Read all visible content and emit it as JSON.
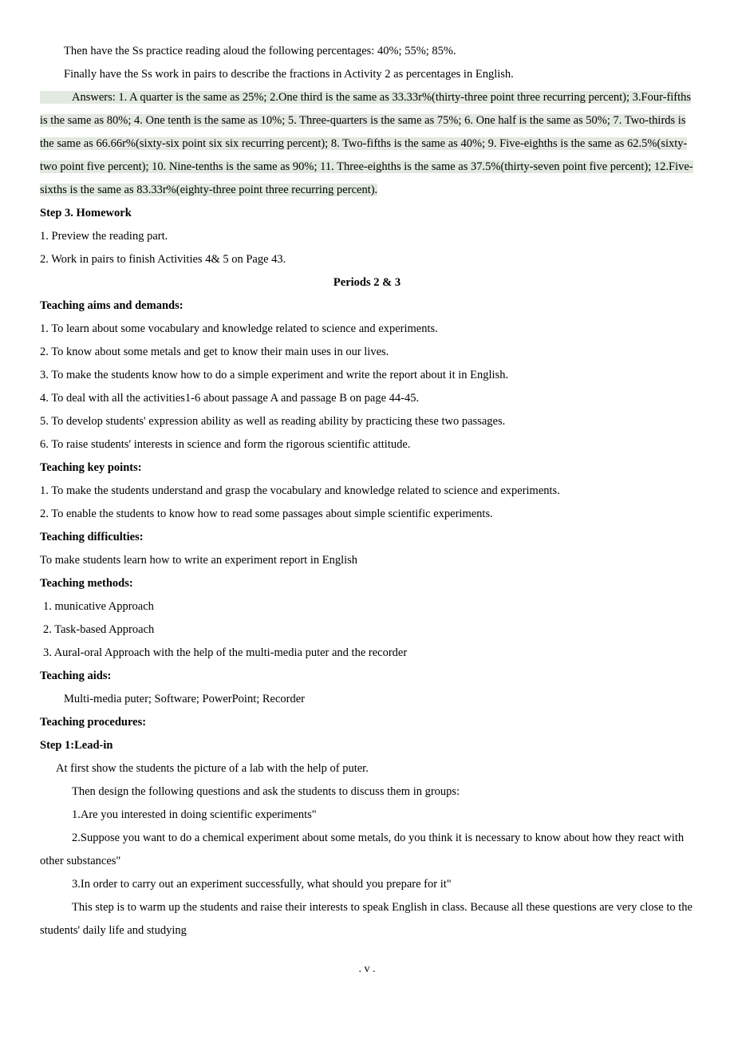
{
  "top": {
    "line1": "Then have the Ss practice reading aloud the following percentages: 40%; 55%; 85%.",
    "line2": "Finally have the Ss work in pairs to describe the fractions in Activity 2 as percentages in English.",
    "answers": "Answers: 1. A quarter is the same as 25%; 2.One third is the same as 33.33r%(thirty-three point three recurring percent); 3.Four-fifths is the same as 80%; 4. One tenth is the same as 10%; 5. Three-quarters is the same as 75%; 6. One half is the same as 50%; 7. Two-thirds is the same as 66.66r%(sixty-six point six six recurring percent); 8. Two-fifths is the same as 40%; 9. Five-eighths is the same as 62.5%(sixty-two point five percent); 10. Nine-tenths is the same as 90%; 11. Three-eighths is the same as 37.5%(thirty-seven point five percent); 12.Five-sixths is the same as 83.33r%(eighty-three point three recurring percent)."
  },
  "step3": {
    "heading": "Step 3. Homework",
    "item1": "1.    Preview the reading part.",
    "item2": "2.    Work in pairs to finish Activities 4& 5 on Page 43."
  },
  "periods": "Periods 2 & 3",
  "aims": {
    "heading": "Teaching aims and demands:",
    "i1": "1. To learn about some vocabulary and knowledge related to science and experiments.",
    "i2": "2. To know about some metals and get to know their main uses in our lives.",
    "i3": "3. To make the students know how to do a simple experiment and write the report about it in English.",
    "i4": "4. To deal with all the activities1-6 about passage A and passage B on page 44-45.",
    "i5": "5. To develop students'  expression ability as well as reading ability by practicing these two passages.",
    "i6": "6. To raise students'  interests in science and form the rigorous scientific attitude."
  },
  "keypoints": {
    "heading": "Teaching key points:",
    "i1": "1. To make the students understand and grasp the vocabulary and knowledge related to science and experiments.",
    "i2": "2. To enable the students to know how to read some passages about simple scientific experiments."
  },
  "difficulties": {
    "heading": "Teaching difficulties:",
    "i1": "To make students learn how to write an experiment report in English"
  },
  "methods": {
    "heading": "Teaching methods:",
    "i1": "1.  municative Approach",
    "i2": "2.  Task-based Approach",
    "i3": "3.  Aural-oral Approach with the help of the multi-media puter and the recorder"
  },
  "aids": {
    "heading": "Teaching aids:",
    "i1": "Multi-media puter; Software; PowerPoint; Recorder"
  },
  "procedures": {
    "heading": "Teaching procedures:",
    "step1heading": "Step 1:Lead-in",
    "l1": "At first show the students the picture of a lab with the help of puter.",
    "l2": "Then design the following questions and ask the students to discuss them in groups:",
    "l3": "1.Are you interested in doing scientific experiments\"",
    "l4": "2.Suppose you want to do a chemical experiment about some metals, do you think it is necessary to know about how they react with other substances\"",
    "l5": "3.In order to carry out an experiment successfully, what should you prepare for it\"",
    "l6": "This step is to warm up the students and raise their interests to speak English in class. Because all these questions are very close to the students'  daily life and studying"
  },
  "footer": ".                                            v                                                 ."
}
